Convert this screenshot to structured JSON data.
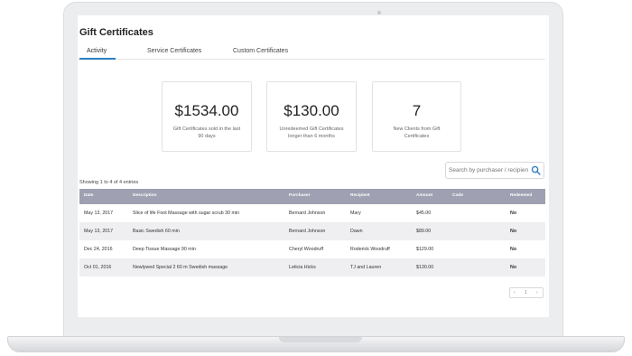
{
  "page": {
    "title": "Gift Certificates"
  },
  "tabs": [
    "Activity",
    "Service Certificates",
    "Custom Certificates"
  ],
  "stats": [
    {
      "value": "$1534.00",
      "caption": "Gift Certificates sold in the last 90 days"
    },
    {
      "value": "$130.00",
      "caption": "Unredeemed Gift Certificates longer than 6 months"
    },
    {
      "value": "7",
      "caption": "New Clients from Gift Certificates"
    }
  ],
  "search": {
    "placeholder": "Search by purchaser / recipient"
  },
  "entries_text": "Showing 1 to 4 of 4 entries",
  "table": {
    "headers": [
      "Date",
      "Description",
      "Purchaser",
      "Recipient",
      "Amount",
      "Code",
      "Redeemed"
    ],
    "rows": [
      [
        "May 13, 2017",
        "Slice of life Foot Massage with sugar scrub 30 min",
        "Bernard Johnson",
        "Mary",
        "$45.00",
        "",
        "No"
      ],
      [
        "May 13, 2017",
        "Basic Swedish 60 min",
        "Bernard Johnson",
        "Dawn",
        "$89.00",
        "",
        "No"
      ],
      [
        "Dec 24, 2016",
        "Deep Tissue Massage 90 min",
        "Cheryl Woodruff",
        "Roderick Woodruff",
        "$129.00",
        "",
        "No"
      ],
      [
        "Oct 01, 2016",
        "Newlywed Special 2 60 m Swedish massage",
        "Leticia Hicks",
        "TJ and Lauren",
        "$130.00",
        "",
        "No"
      ]
    ]
  },
  "pager": {
    "prev": "‹",
    "page": "1",
    "next": "›"
  },
  "colors": {
    "accent": "#2d7fc1",
    "table_header": "#9fa0b1",
    "alt_row": "#efeff1"
  }
}
